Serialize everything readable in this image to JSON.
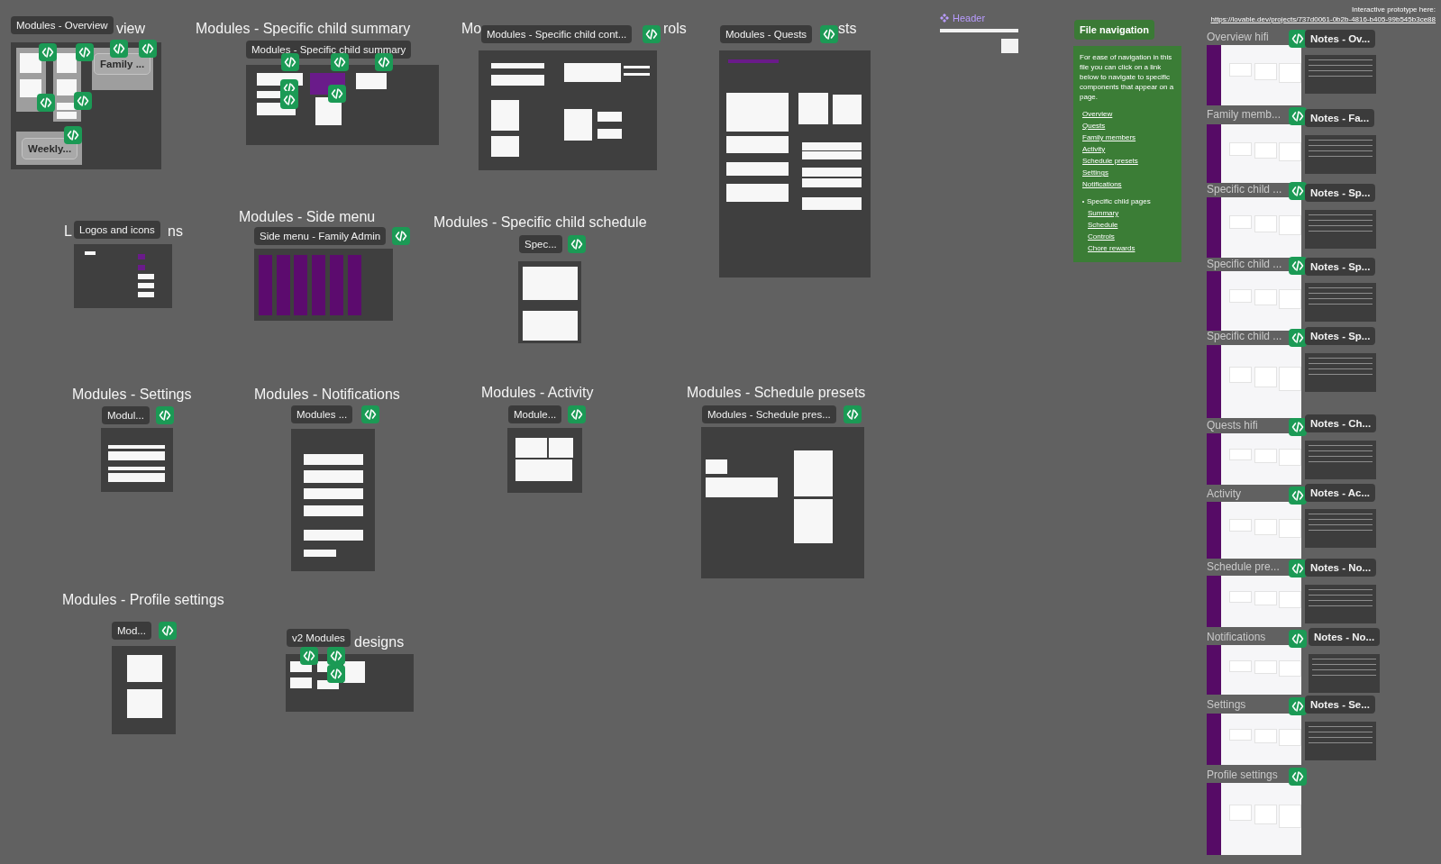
{
  "canvas_frames": [
    {
      "title_parts": [
        "view"
      ],
      "label": "Modules - Overview",
      "inner_labels": [
        "Family ...",
        "Weekly..."
      ]
    },
    {
      "title_parts": [
        "Modules - Specific child summary"
      ],
      "label": "Modules - Specific child summary"
    },
    {
      "title_parts": [
        "Mo",
        "rols"
      ],
      "label": "Modules - Specific child cont..."
    },
    {
      "title_parts": [
        "sts"
      ],
      "label": "Modules - Quests"
    },
    {
      "title_parts": [
        "L",
        "ns"
      ],
      "label": "Logos and icons"
    },
    {
      "title_parts": [
        "Modules - Side menu"
      ],
      "label": "Side menu - Family Admin"
    },
    {
      "title_parts": [
        "Modules - Specific child schedule"
      ],
      "label": "Spec..."
    },
    {
      "title_parts": [
        "Modules - Settings"
      ],
      "label": "Modul..."
    },
    {
      "title_parts": [
        "Modules - Notifications"
      ],
      "label": "Modules ..."
    },
    {
      "title_parts": [
        "Modules - Activity"
      ],
      "label": "Module..."
    },
    {
      "title_parts": [
        "Modules - Schedule presets"
      ],
      "label": "Modules - Schedule pres..."
    },
    {
      "title_parts": [
        "Modules - Profile settings"
      ],
      "label": "Mod..."
    },
    {
      "title_parts": [
        "designs"
      ],
      "label": "v2 Modules"
    }
  ],
  "header_component": {
    "label": "Header"
  },
  "file_navigation": {
    "title": "File navigation",
    "description": "For ease of navigation in this file you can click on a link below to navigate to specific components that appear on a page.",
    "links": [
      "Overview",
      "Quests",
      "Family members",
      "Activity",
      "Schedule presets",
      "Settings",
      "Notifications"
    ],
    "sub_heading": "Specific child pages",
    "sub_links": [
      "Summary",
      "Schedule",
      "Controls",
      "Chore rewards"
    ]
  },
  "prototype_note": {
    "label": "Interactive prototype here:",
    "url": "https://lovable.dev/projects/737d0061-0b2b-4816-b405-99b545b3ce88"
  },
  "hifi_pages": [
    {
      "label": "Overview hifi",
      "notes": "Notes - Ov..."
    },
    {
      "label": "Family memb...",
      "notes": "Notes - Fa..."
    },
    {
      "label": "Specific child ...",
      "notes": "Notes - Sp..."
    },
    {
      "label": "Specific child ...",
      "notes": "Notes - Sp..."
    },
    {
      "label": "Specific child ...",
      "notes": "Notes - Sp..."
    },
    {
      "label": "Quests hifi",
      "notes": "Notes - Ch..."
    },
    {
      "label": "Activity",
      "notes": "Notes - Ac..."
    },
    {
      "label": "Schedule pre...",
      "notes": "Notes - No..."
    },
    {
      "label": "Notifications",
      "notes": "Notes - No..."
    },
    {
      "label": "Settings",
      "notes": "Notes - Se..."
    },
    {
      "label": "Profile settings"
    }
  ]
}
